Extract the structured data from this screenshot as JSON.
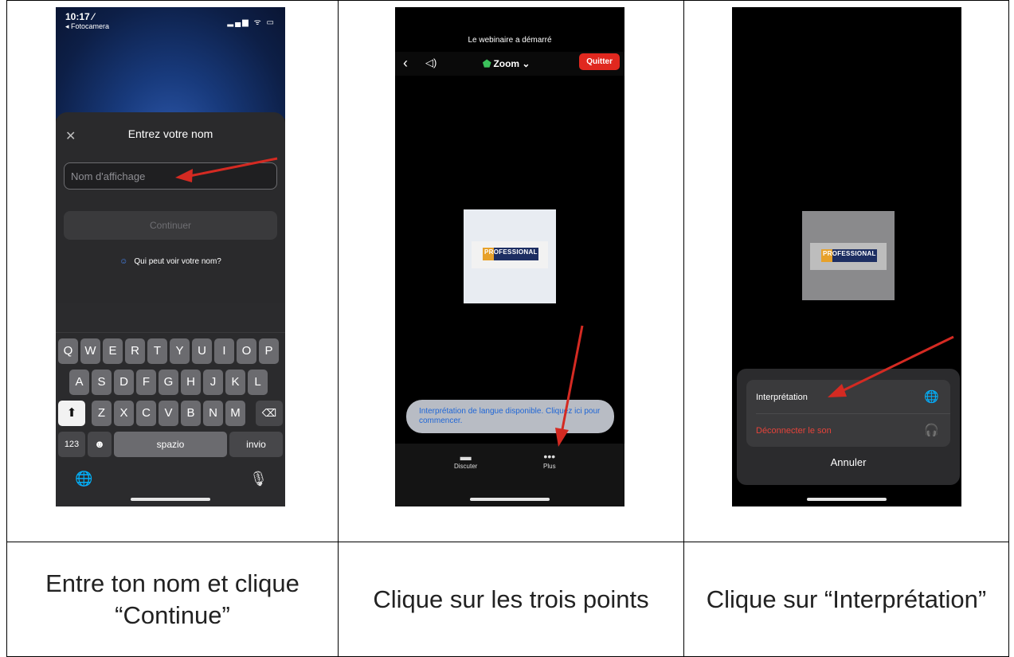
{
  "steps": [
    {
      "caption": "Entre ton nom et clique “Continue”",
      "screen": {
        "time": "10:17 ⁄",
        "back_app": "◂ Fotocamera",
        "sheet_title": "Entrez votre nom",
        "name_placeholder": "Nom d'affichage",
        "continue_label": "Continuer",
        "who_link": "Qui peut voir votre nom?",
        "keyboard": {
          "row1": [
            "Q",
            "W",
            "E",
            "R",
            "T",
            "Y",
            "U",
            "I",
            "O",
            "P"
          ],
          "row2": [
            "A",
            "S",
            "D",
            "F",
            "G",
            "H",
            "J",
            "K",
            "L"
          ],
          "row3": [
            "Z",
            "X",
            "C",
            "V",
            "B",
            "N",
            "M"
          ],
          "numbers_key": "123",
          "space_key": "spazio",
          "return_key": "invio"
        }
      }
    },
    {
      "caption": "Clique sur les trois points",
      "screen": {
        "banner": "Le webinaire a démarré",
        "meeting_name": "Zoom ⌄",
        "quit_label": "Quitter",
        "logo_text": "PROFESSIONAL",
        "toast": "Interprétation de langue disponible. Cliquez ici pour commencer.",
        "tabs": [
          {
            "icon": "chat-icon",
            "label": "Discuter"
          },
          {
            "icon": "more-icon",
            "label": "Plus"
          }
        ]
      }
    },
    {
      "caption": "Clique sur “Interprétation”",
      "screen": {
        "logo_text": "PROFESSIONAL",
        "menu": [
          {
            "label": "Interprétation",
            "icon": "globe-icon"
          },
          {
            "label": "Déconnecter le son",
            "icon": "headphones-off-icon",
            "color": "#e5433a"
          }
        ],
        "cancel_label": "Annuler"
      }
    }
  ],
  "colors": {
    "arrow": "#d42a22",
    "quit": "#e0281f",
    "link": "#1f66d6"
  }
}
